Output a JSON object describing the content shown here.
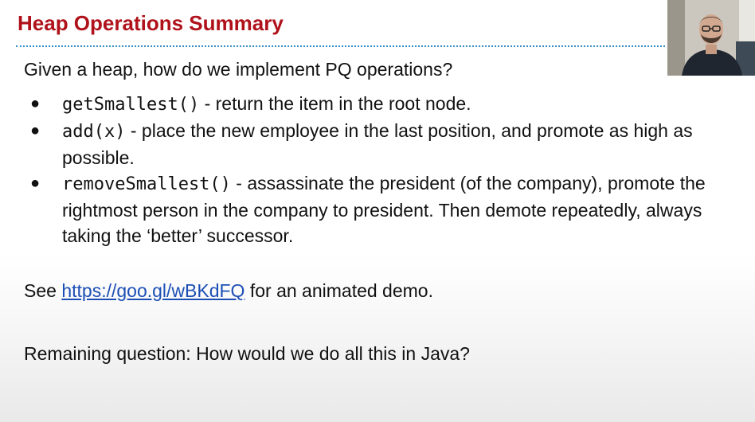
{
  "slide": {
    "title": "Heap Operations Summary",
    "intro": "Given a heap, how do we implement PQ operations?",
    "bullets": [
      {
        "bullet": "●",
        "code": "getSmallest()",
        "text": " - return the item in the root node."
      },
      {
        "bullet": "●",
        "code": "add(x)",
        "text": " - place the new employee in the last position, and promote as high as possible."
      },
      {
        "bullet": "●",
        "code": "removeSmallest()",
        "text": " - assassinate the president (of the company), promote the rightmost person in the company to president. Then demote repeatedly, always taking the ‘better’ successor."
      }
    ],
    "demo": {
      "prefix": "See ",
      "link_text": "https://goo.gl/wBKdFQ",
      "suffix": " for an animated demo."
    },
    "question": "Remaining question: How would we do all this in Java?"
  },
  "colors": {
    "title": "#b0121b",
    "divider": "#3a8fc8",
    "link": "#1c4fb5"
  }
}
